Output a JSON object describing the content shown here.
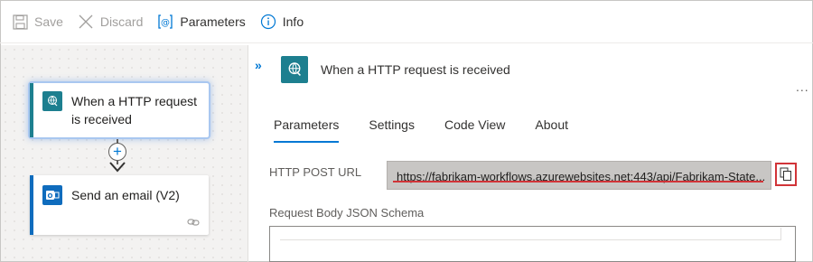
{
  "toolbar": {
    "save": "Save",
    "discard": "Discard",
    "parameters": "Parameters",
    "info": "Info"
  },
  "canvas": {
    "trigger_card": {
      "label_line1": "When a HTTP request",
      "label_line2": "is received",
      "icon": "globe-icon"
    },
    "action_card": {
      "label": "Send an email (V2)",
      "icon": "outlook-icon",
      "link_icon": "link-icon"
    },
    "add_step_icon": "plus-icon"
  },
  "panel": {
    "title": "When a HTTP request is received",
    "collapse_glyph": "»",
    "more_glyph": "...",
    "tabs": [
      {
        "label": "Parameters",
        "selected": true
      },
      {
        "label": "Settings",
        "selected": false
      },
      {
        "label": "Code View",
        "selected": false
      },
      {
        "label": "About",
        "selected": false
      }
    ],
    "http_post_url_label": "HTTP POST URL",
    "http_post_url_value": "https://fabrikam-workflows.azurewebsites.net:443/api/Fabrikam-State...",
    "schema_label": "Request Body JSON Schema"
  },
  "colors": {
    "accent": "#0078d4",
    "trigger_teal": "#1d7f8f",
    "outlook_blue": "#0f6cbd",
    "highlight_red": "#d13438"
  }
}
